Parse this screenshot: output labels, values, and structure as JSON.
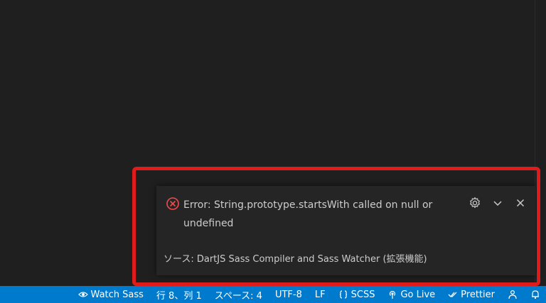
{
  "notification": {
    "message": "Error: String.prototype.startsWith called on null or undefined",
    "source": "ソース: DartJS Sass Compiler and Sass Watcher (拡張機能)",
    "icon": "error-circle-icon",
    "actions": [
      "gear-icon",
      "chevron-down-icon",
      "close-icon"
    ],
    "colors": {
      "error": "#f14c4c",
      "highlight": "#e01b1b"
    }
  },
  "statusbar": {
    "watch_sass": "Watch Sass",
    "cursor_position": "行 8、列 1",
    "indentation": "スペース: 4",
    "encoding": "UTF-8",
    "eol": "LF",
    "language": "SCSS",
    "go_live": "Go Live",
    "prettier": "Prettier",
    "color": "#007acc"
  }
}
